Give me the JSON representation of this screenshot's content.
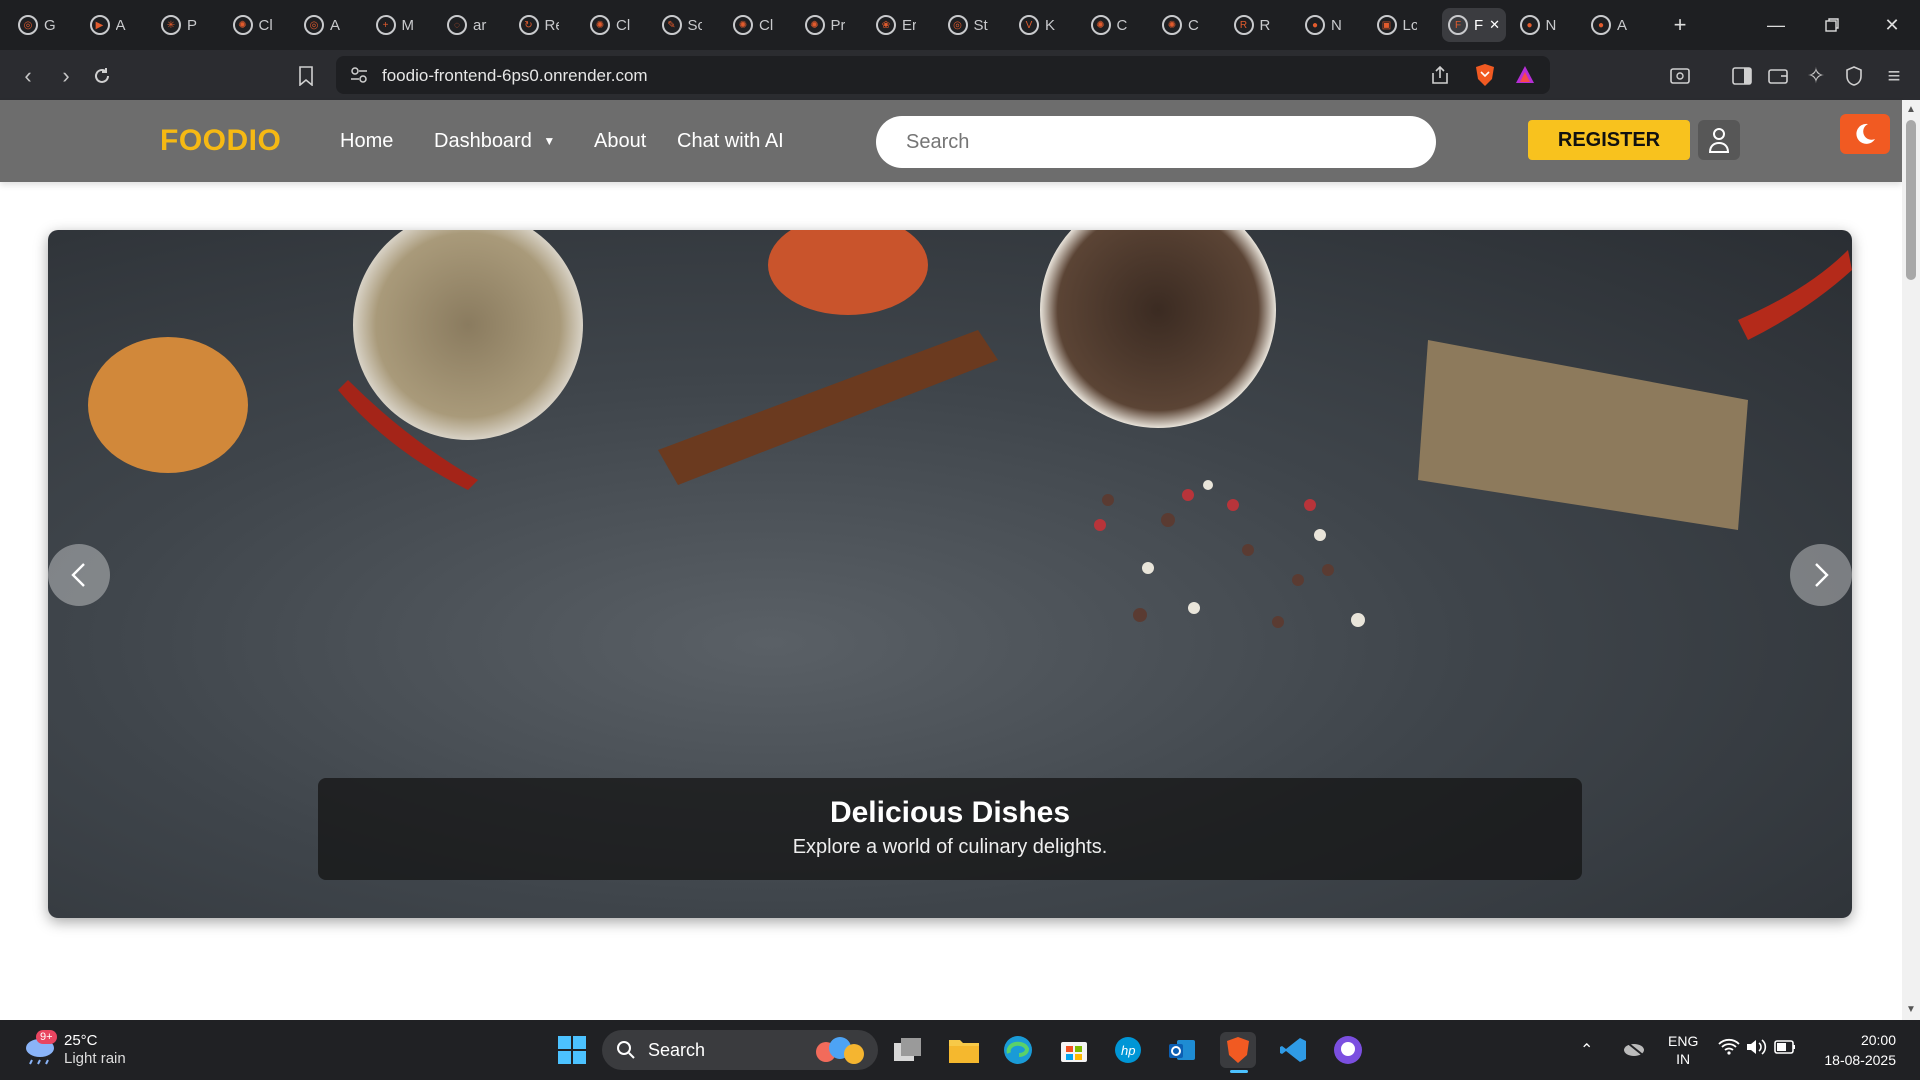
{
  "browser": {
    "tabs": [
      {
        "label": "G",
        "icon": "openai-icon"
      },
      {
        "label": "A",
        "icon": "youtube-icon"
      },
      {
        "label": "P",
        "icon": "perplexity-icon"
      },
      {
        "label": "Cl",
        "icon": "claude-icon"
      },
      {
        "label": "A",
        "icon": "openai-icon"
      },
      {
        "label": "M",
        "icon": "plus-icon"
      },
      {
        "label": "ar",
        "icon": "loading-icon"
      },
      {
        "label": "Re",
        "icon": "refresh-icon"
      },
      {
        "label": "Cl",
        "icon": "claude-icon"
      },
      {
        "label": "Sc",
        "icon": "scribe-icon"
      },
      {
        "label": "Cl",
        "icon": "claude-icon"
      },
      {
        "label": "Pr",
        "icon": "claude-icon"
      },
      {
        "label": "Er",
        "icon": "chatgpt-icon"
      },
      {
        "label": "St",
        "icon": "openai-icon"
      },
      {
        "label": "K",
        "icon": "v-icon"
      },
      {
        "label": "C",
        "icon": "claude-icon"
      },
      {
        "label": "C",
        "icon": "claude-icon"
      },
      {
        "label": "R",
        "icon": "r-icon"
      },
      {
        "label": "N",
        "icon": "github-icon"
      },
      {
        "label": "Lc",
        "icon": "leetcode-icon"
      },
      {
        "label": "Fc",
        "icon": "foodio-icon",
        "active": true
      },
      {
        "label": "N",
        "icon": "github-icon"
      },
      {
        "label": "A",
        "icon": "github-icon"
      }
    ],
    "url": "foodio-frontend-6ps0.onrender.com"
  },
  "site": {
    "logo": "FOODIO",
    "nav": {
      "home": "Home",
      "dashboard": "Dashboard",
      "about": "About",
      "chat": "Chat with AI"
    },
    "search_placeholder": "Search",
    "register": "REGISTER",
    "accent": "#f8c21e",
    "dark_toggle_color": "#f15a22"
  },
  "carousel": {
    "title": "Delicious Dishes",
    "subtitle": "Explore a world of culinary delights."
  },
  "taskbar": {
    "weather_temp": "25°C",
    "weather_desc": "Light rain",
    "weather_badge": "9+",
    "search_label": "Search",
    "lang_1": "ENG",
    "lang_2": "IN",
    "time": "20:00",
    "date": "18-08-2025"
  }
}
